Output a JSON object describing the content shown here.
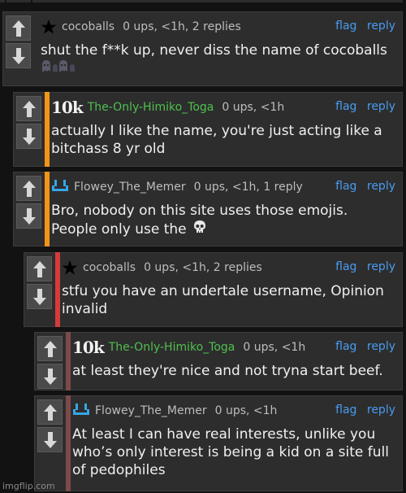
{
  "colors": {
    "background": "#121212",
    "panel": "#2d2d2d",
    "link": "#4a9bf0",
    "username_green": "#4fc04f",
    "depth_orange": "#f29418",
    "depth_red": "#d43b3b",
    "depth_rose": "#7b4a4a"
  },
  "actions": {
    "flag": "flag",
    "reply": "reply"
  },
  "comments": [
    {
      "username": "cocoballs",
      "badge": "star-icon",
      "stats": "0 ups, <1h, 2 replies",
      "body": "shut the f**k up, never diss the name of cocoballs",
      "trailing_emoji": "ghost-icons"
    },
    {
      "username": "The-Only-Himiko_Toga",
      "badge": "10k",
      "stats": "0 ups, <1h",
      "body": "actually I like the name, you're just acting like a bitchass 8 yr old",
      "depth_color": "#f29418"
    },
    {
      "username": "Flowey_The_Memer",
      "badge": "smiley-icon",
      "stats": "0 ups, <1h, 1 reply",
      "body": "Bro, nobody on this site uses those emojis. People only use the",
      "trailing_emoji": "skull-icon",
      "depth_color": "#f29418"
    },
    {
      "username": "cocoballs",
      "badge": "star-icon",
      "stats": "0 ups, <1h, 2 replies",
      "body": "stfu you have an undertale username, Opinion invalid",
      "depth_color": "#d43b3b"
    },
    {
      "username": "The-Only-Himiko_Toga",
      "badge": "10k",
      "stats": "0 ups, <1h",
      "body": "at least they're nice and not tryna start beef.",
      "depth_color": "#7b4a4a"
    },
    {
      "username": "Flowey_The_Memer",
      "badge": "smiley-icon",
      "stats": "0 ups, <1h",
      "body": "At least I can have real interests, unlike you who’s only interest is being a kid on a site full of pedophiles",
      "depth_color": "#7b4a4a"
    }
  ],
  "footer": {
    "watermark": "imgflip.com"
  }
}
